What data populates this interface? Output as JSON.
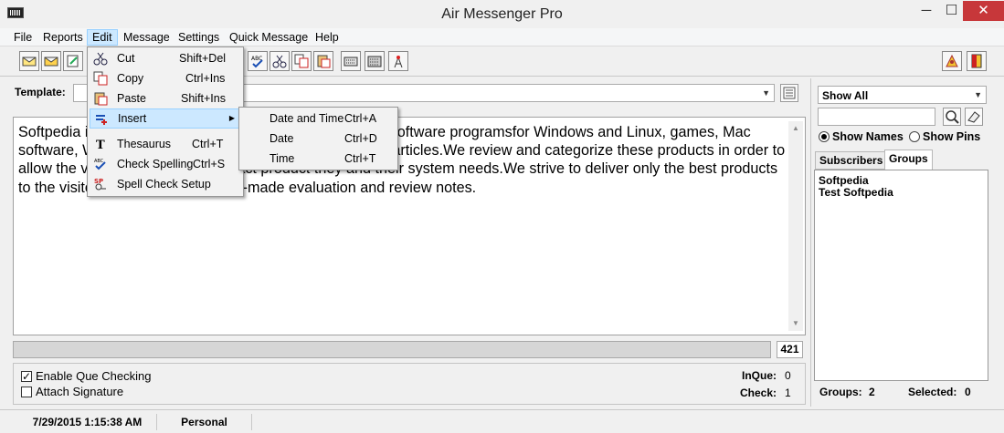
{
  "window": {
    "title": "Air Messenger Pro",
    "minimize": "─",
    "maximize": "☐",
    "close": "✕"
  },
  "menubar": {
    "items": [
      "File",
      "Reports",
      "Edit",
      "Message",
      "Settings",
      "Quick Message",
      "Help"
    ]
  },
  "template": {
    "label": "Template:",
    "value": ""
  },
  "editor": {
    "text": "Softpedia is a library of over 800,000 free and free-to-try software programsfor Windows and Linux, games, Mac software, Windows drivers, mobile devicesand IT-related articles.We review and categorize these products in order to allow the visitor/userto find the exact product they and their system needs.We strive to deliver only the best products to the visitor/usertogether with self-made evaluation and review notes.",
    "char_count": "421"
  },
  "options": {
    "enable_que": {
      "label": "Enable Que Checking",
      "checked": true
    },
    "attach_signature": {
      "label": "Attach Signature",
      "checked": false
    },
    "inque_label": "InQue:",
    "inque_value": "0",
    "check_label": "Check:",
    "check_value": "1"
  },
  "sidebar": {
    "filter_value": "Show All",
    "search_value": "",
    "show_names": "Show Names",
    "show_pins": "Show Pins",
    "tabs": [
      "Subscribers",
      "Groups"
    ],
    "active_tab": "Groups",
    "groups": [
      "Softpedia",
      "Test Softpedia"
    ],
    "groups_label": "Groups:",
    "groups_value": "2",
    "selected_label": "Selected:",
    "selected_value": "0"
  },
  "status": {
    "datetime": "7/29/2015 1:15:38 AM",
    "profile": "Personal"
  },
  "edit_menu": {
    "items": [
      {
        "label": "Cut",
        "shortcut": "Shift+Del",
        "icon": "cut-icon"
      },
      {
        "label": "Copy",
        "shortcut": "Ctrl+Ins",
        "icon": "copy-icon"
      },
      {
        "label": "Paste",
        "shortcut": "Shift+Ins",
        "icon": "paste-icon"
      },
      {
        "label": "Insert",
        "shortcut": "",
        "icon": "insert-icon"
      },
      {
        "label": "Thesaurus",
        "shortcut": "Ctrl+T",
        "icon": "thesaurus-icon"
      },
      {
        "label": "Check Spelling",
        "shortcut": "Ctrl+S",
        "icon": "spellcheck-icon"
      },
      {
        "label": "Spell Check Setup",
        "shortcut": "",
        "icon": "spell-setup-icon"
      }
    ]
  },
  "insert_submenu": {
    "items": [
      {
        "label": "Date and Time",
        "shortcut": "Ctrl+A"
      },
      {
        "label": "Date",
        "shortcut": "Ctrl+D"
      },
      {
        "label": "Time",
        "shortcut": "Ctrl+T"
      }
    ]
  },
  "colors": {
    "menu_highlight": "#cce8ff",
    "close_button": "#c7373a"
  }
}
